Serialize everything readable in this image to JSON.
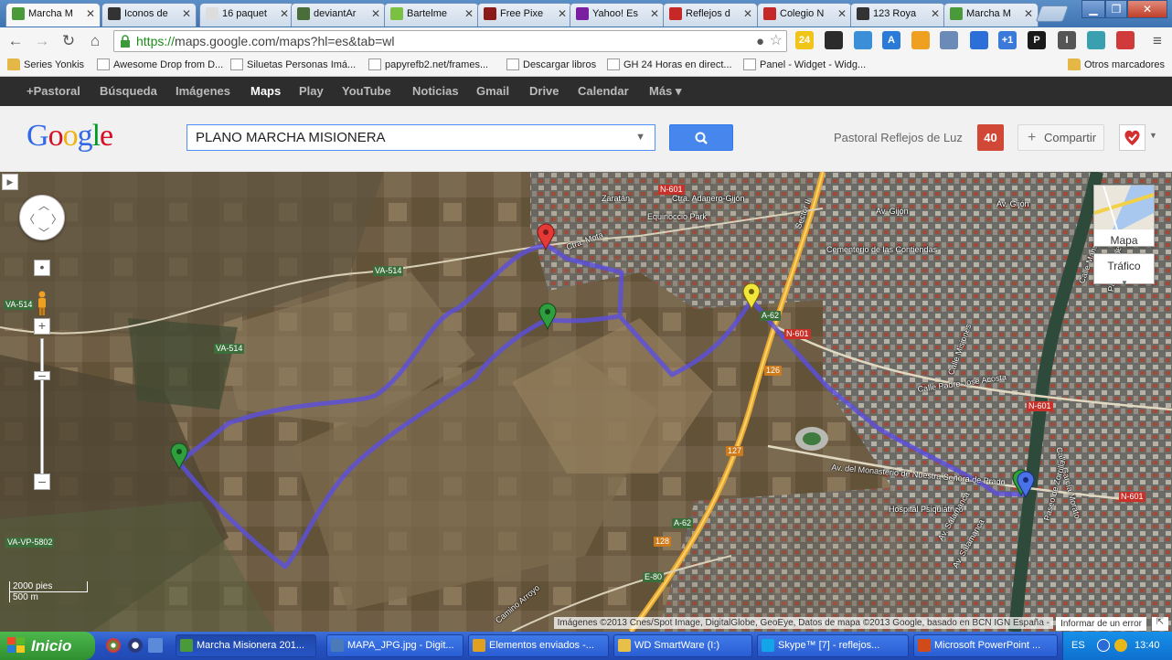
{
  "window": {
    "minimize": "▁",
    "restore": "❐",
    "close": "✕"
  },
  "tabs": [
    {
      "label": "Marcha M",
      "active": true,
      "color": "#4a9a3a"
    },
    {
      "label": "Iconos de",
      "active": false,
      "color": "#333"
    },
    {
      "label": "16 paquet",
      "active": false,
      "color": "#ddd"
    },
    {
      "label": "deviantAr",
      "active": false,
      "color": "#4a6e3a"
    },
    {
      "label": "Bartelme",
      "active": false,
      "color": "#7bc043"
    },
    {
      "label": "Free Pixe",
      "active": false,
      "color": "#8b1a1a"
    },
    {
      "label": "Yahoo! Es",
      "active": false,
      "color": "#7b1fa2"
    },
    {
      "label": "Reflejos d",
      "active": false,
      "color": "#c62828"
    },
    {
      "label": "Colegio N",
      "active": false,
      "color": "#c62828"
    },
    {
      "label": "123 Roya",
      "active": false,
      "color": "#333"
    },
    {
      "label": "Marcha M",
      "active": false,
      "color": "#4a9a3a"
    }
  ],
  "toolbar": {
    "back": "←",
    "forward": "→",
    "reload": "↻",
    "home": "⌂",
    "url_secure": "https://",
    "url_rest": "maps.google.com/maps?hl=es&tab=wl",
    "extensions": [
      {
        "label": "24",
        "color": "#f0c419"
      },
      {
        "label": "",
        "color": "#2b2b2b"
      },
      {
        "label": "",
        "color": "#3b8fd8"
      },
      {
        "label": "A",
        "color": "#2a7ad8"
      },
      {
        "label": "",
        "color": "#f0a020"
      },
      {
        "label": "",
        "color": "#6c8ab8"
      },
      {
        "label": "",
        "color": "#2d6fd8"
      },
      {
        "label": "+1",
        "color": "#3b7ad8"
      },
      {
        "label": "P",
        "color": "#1a1a1a"
      },
      {
        "label": "I",
        "color": "#555"
      },
      {
        "label": "",
        "color": "#3aa0b0"
      },
      {
        "label": "",
        "color": "#d03a3a"
      }
    ],
    "menu": "≡"
  },
  "bookmarks": [
    {
      "label": "Series Yonkis",
      "folder": true
    },
    {
      "label": "Awesome Drop from D...",
      "folder": false
    },
    {
      "label": "Siluetas Personas Imá...",
      "folder": false
    },
    {
      "label": "papyrefb2.net/frames...",
      "folder": false
    },
    {
      "label": "Descargar libros",
      "folder": false
    },
    {
      "label": "GH 24 Horas en direct...",
      "folder": false
    },
    {
      "label": "Panel - Widget - Widg...",
      "folder": false
    }
  ],
  "other_bookmarks": "Otros marcadores",
  "gbar": [
    {
      "label": "+Pastoral",
      "active": false
    },
    {
      "label": "Búsqueda",
      "active": false
    },
    {
      "label": "Imágenes",
      "active": false
    },
    {
      "label": "Maps",
      "active": true
    },
    {
      "label": "Play",
      "active": false
    },
    {
      "label": "YouTube",
      "active": false
    },
    {
      "label": "Noticias",
      "active": false
    },
    {
      "label": "Gmail",
      "active": false
    },
    {
      "label": "Drive",
      "active": false
    },
    {
      "label": "Calendar",
      "active": false
    },
    {
      "label": "Más ▾",
      "active": false
    }
  ],
  "header": {
    "logo": [
      "G",
      "o",
      "o",
      "g",
      "l",
      "e"
    ],
    "logo_colors": [
      "#3369e8",
      "#d50f25",
      "#eeb211",
      "#3369e8",
      "#009925",
      "#d50f25"
    ],
    "search_value": "PLANO MARCHA MISIONERA",
    "user": "Pastoral Reflejos de Luz",
    "notifications": "40",
    "share": "Compartir"
  },
  "map": {
    "roads": [
      {
        "label": "N-601",
        "style": "red"
      },
      {
        "label": "VA-514",
        "style": "green"
      },
      {
        "label": "VA-514",
        "style": "green"
      },
      {
        "label": "VA-514",
        "style": "green"
      },
      {
        "label": "A-62",
        "style": "green"
      },
      {
        "label": "N-601",
        "style": "red"
      },
      {
        "label": "126",
        "style": "orange"
      },
      {
        "label": "127",
        "style": "orange"
      },
      {
        "label": "128",
        "style": "orange"
      },
      {
        "label": "A-62",
        "style": "green"
      },
      {
        "label": "E-80",
        "style": "green"
      },
      {
        "label": "N-601",
        "style": "red"
      },
      {
        "label": "N-601",
        "style": "red"
      },
      {
        "label": "VA-VP-5802",
        "style": "green"
      }
    ],
    "places": [
      "Zaratán",
      "Ctra. Adanero-Gijón",
      "Equinoccio Park",
      "Av. Gijón",
      "Av. Gijón",
      "Cementerio de las Contiendas",
      "Ctra. Mota",
      "Sector II",
      "Calle Padre José Acosta",
      "Av. del Monasterio de Nuestra Señora de Prado",
      "Hospital Psiquiátrico",
      "Av. Salamanca",
      "Camino Arroyo",
      "Calle García Morato",
      "Paseo de Zorrilla",
      "Paseo Isabel la Católica",
      "Av. Salamanca",
      "Calle Misiones",
      "Calle Manuel Azaña"
    ],
    "map_types": {
      "map": "Mapa",
      "traffic": "Tráfico"
    },
    "scale": {
      "imperial": "2000 pies",
      "metric": "500 m"
    },
    "attribution": "Imágenes ©2013 Cnes/Spot Image, DigitalGlobe, GeoEye, Datos de mapa ©2013 Google, basado en BCN IGN España -",
    "report": "Informar de un error",
    "marker_colors": {
      "red": "#e53935",
      "green": "#2e9e3e",
      "yellow": "#f2e63a",
      "blue": "#4a72e8"
    },
    "route_color": "#5b4fe0"
  },
  "taskbar": {
    "start": "Inicio",
    "tasks": [
      {
        "label": "Marcha Misionera 201...",
        "active": true,
        "color": "#4a9a3a"
      },
      {
        "label": "MAPA_JPG.jpg - Digit...",
        "active": false,
        "color": "#4a7ab8"
      },
      {
        "label": "Elementos enviados -...",
        "active": false,
        "color": "#e0a020"
      },
      {
        "label": "WD SmartWare (I:)",
        "active": false,
        "color": "#e8c048"
      },
      {
        "label": "Skype™ [7] - reflejos...",
        "active": false,
        "color": "#12a5e8"
      },
      {
        "label": "Microsoft PowerPoint ...",
        "active": false,
        "color": "#d04a1a"
      }
    ],
    "lang": "ES",
    "clock": "13:40"
  }
}
